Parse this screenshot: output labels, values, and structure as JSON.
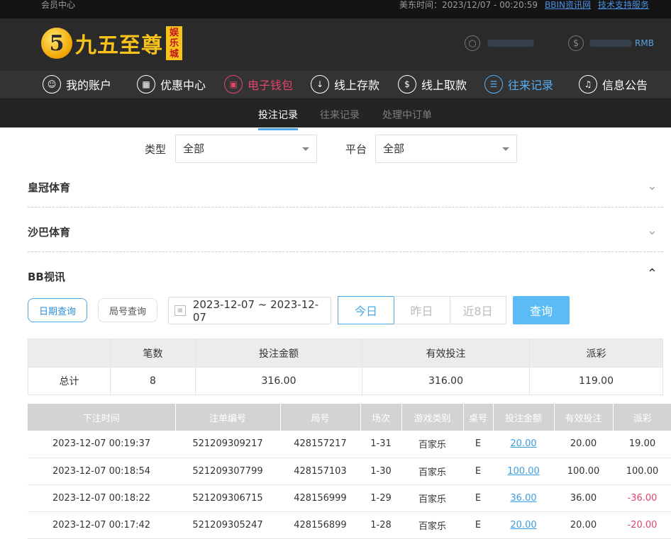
{
  "topbar": {
    "left": "会员中心",
    "time": "美东时间：2023/12/07 - 00:20:59",
    "link1": "BBIN资讯网",
    "link2": "技术支持服务"
  },
  "header": {
    "logo_num": "5",
    "logo_text": "九五至尊",
    "logo_badge": [
      "娱",
      "乐",
      "城"
    ],
    "currency": "RMB"
  },
  "nav": [
    {
      "label": "我的账户",
      "icon": "user-icon"
    },
    {
      "label": "优惠中心",
      "icon": "gift-icon"
    },
    {
      "label": "电子钱包",
      "icon": "wallet-icon"
    },
    {
      "label": "线上存款",
      "icon": "deposit-icon"
    },
    {
      "label": "线上取款",
      "icon": "withdraw-icon"
    },
    {
      "label": "往来记录",
      "icon": "records-icon"
    },
    {
      "label": "信息公告",
      "icon": "bell-icon"
    }
  ],
  "subnav": [
    "投注记录",
    "往来记录",
    "处理中订单"
  ],
  "filters": {
    "type_label": "类型",
    "type_value": "全部",
    "platform_label": "平台",
    "platform_value": "全部"
  },
  "sections": [
    "皇冠体育",
    "沙巴体育",
    "BB视讯"
  ],
  "query": {
    "date_btn": "日期查询",
    "round_btn": "局号查询",
    "date_range": "2023-12-07 ~ 2023-12-07",
    "today": "今日",
    "yesterday": "昨日",
    "last8": "近8日",
    "submit": "查询"
  },
  "summary": {
    "headers": [
      "",
      "笔数",
      "投注金额",
      "有效投注",
      "派彩"
    ],
    "row": [
      "总计",
      "8",
      "316.00",
      "316.00",
      "119.00"
    ]
  },
  "detail": {
    "headers": [
      "下注时间",
      "注单编号",
      "局号",
      "场次",
      "游戏类别",
      "桌号",
      "投注金额",
      "有效投注",
      "派彩"
    ],
    "rows": [
      [
        "2023-12-07 00:19:37",
        "521209309217",
        "428157217",
        "1-31",
        "百家乐",
        "E",
        "20.00",
        "20.00",
        "19.00"
      ],
      [
        "2023-12-07 00:18:54",
        "521209307799",
        "428157103",
        "1-30",
        "百家乐",
        "E",
        "100.00",
        "100.00",
        "100.00"
      ],
      [
        "2023-12-07 00:18:22",
        "521209306715",
        "428156999",
        "1-29",
        "百家乐",
        "E",
        "36.00",
        "36.00",
        "-36.00"
      ],
      [
        "2023-12-07 00:17:42",
        "521209305247",
        "428156899",
        "1-28",
        "百家乐",
        "E",
        "20.00",
        "20.00",
        "-20.00"
      ]
    ]
  }
}
